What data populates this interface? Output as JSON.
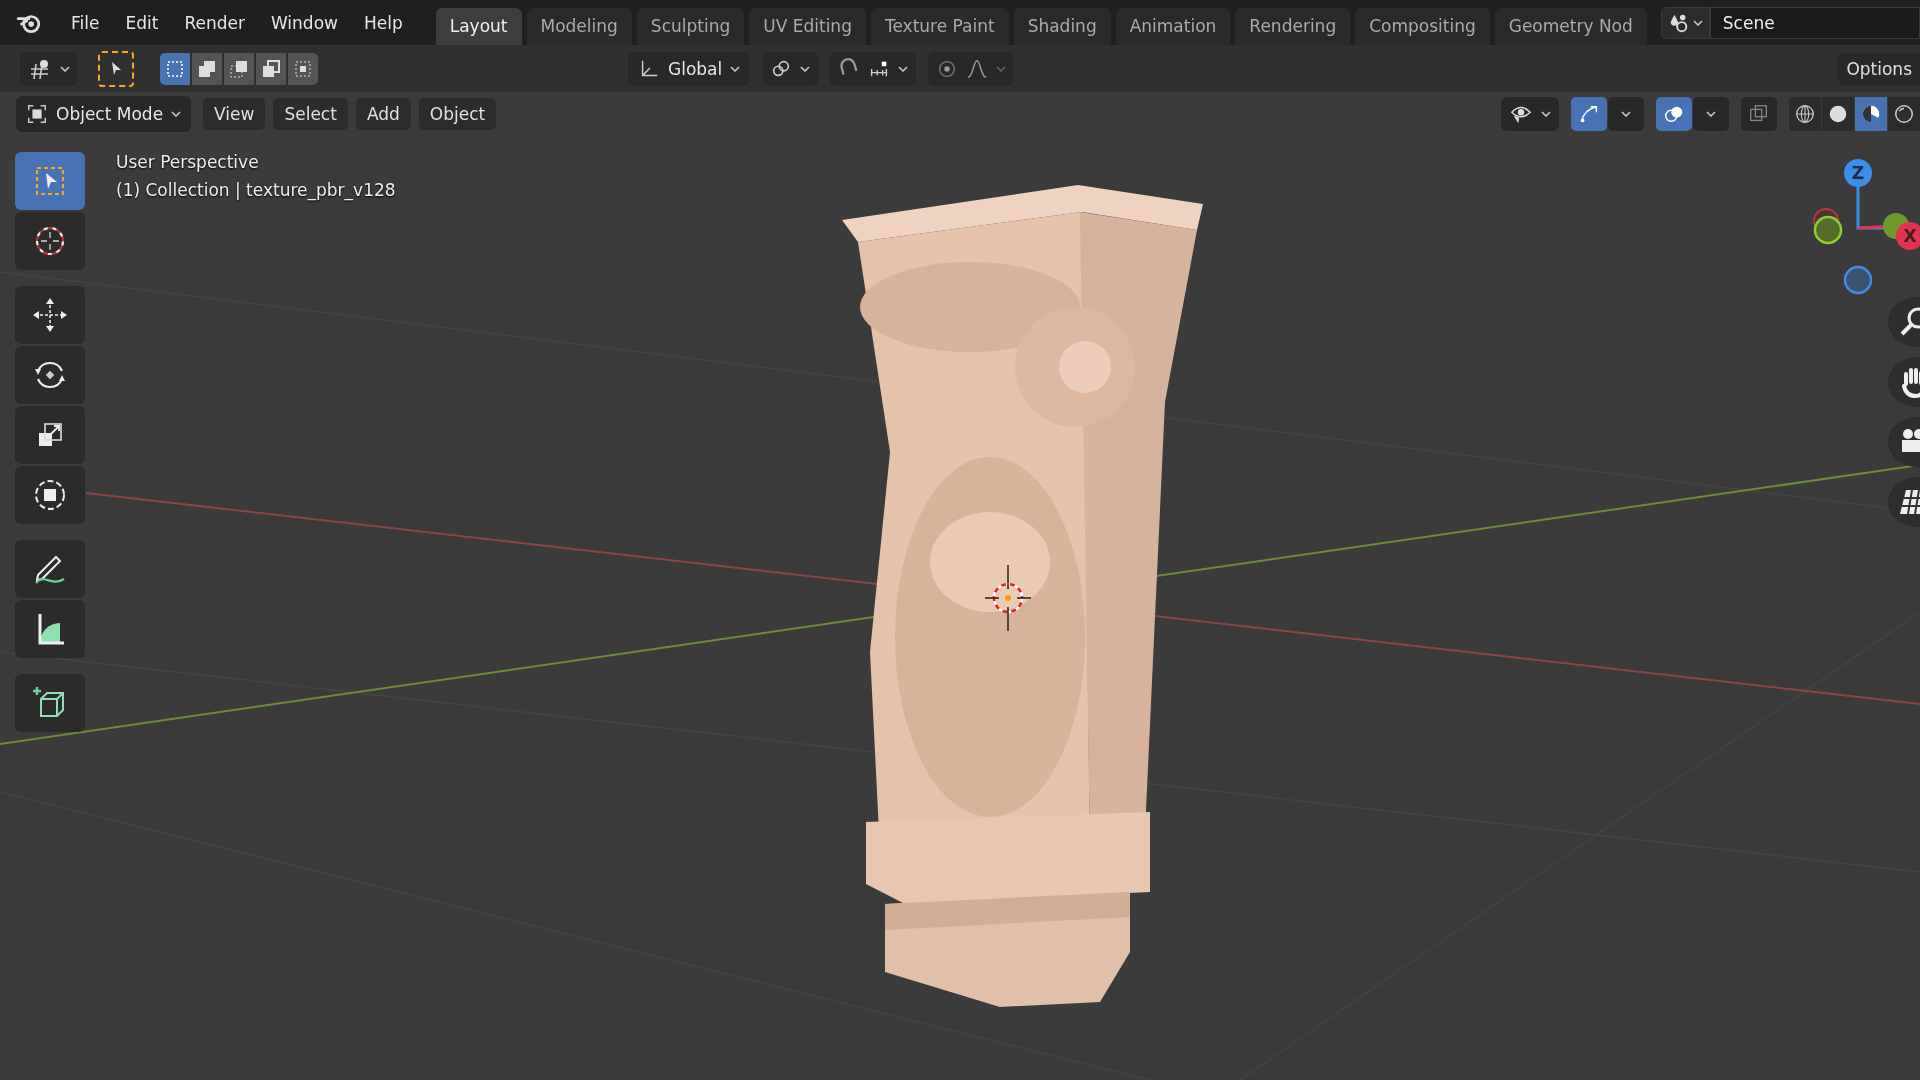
{
  "menu": [
    "File",
    "Edit",
    "Render",
    "Window",
    "Help"
  ],
  "workspace_tabs": [
    {
      "label": "Layout",
      "selected": true
    },
    {
      "label": "Modeling",
      "selected": false
    },
    {
      "label": "Sculpting",
      "selected": false
    },
    {
      "label": "UV Editing",
      "selected": false
    },
    {
      "label": "Texture Paint",
      "selected": false
    },
    {
      "label": "Shading",
      "selected": false
    },
    {
      "label": "Animation",
      "selected": false
    },
    {
      "label": "Rendering",
      "selected": false
    },
    {
      "label": "Compositing",
      "selected": false
    },
    {
      "label": "Geometry Nod",
      "selected": false
    }
  ],
  "scene": {
    "name": "Scene"
  },
  "tool_header": {
    "select_modes": [
      {
        "kind": "set",
        "selected": true
      },
      {
        "kind": "extend",
        "selected": false
      },
      {
        "kind": "subtract",
        "selected": false
      },
      {
        "kind": "invert",
        "selected": false
      },
      {
        "kind": "intersect",
        "selected": false
      }
    ],
    "orientation": "Global",
    "options": "Options"
  },
  "viewport_header": {
    "mode": "Object Mode",
    "menus": [
      "View",
      "Select",
      "Add",
      "Object"
    ],
    "toggles": [
      {
        "kind": "gizmos",
        "on": true
      },
      {
        "kind": "overlays",
        "on": true
      },
      {
        "kind": "xray",
        "on": false
      }
    ],
    "shading_modes": [
      {
        "kind": "wireframe",
        "selected": false
      },
      {
        "kind": "solid",
        "selected": false
      },
      {
        "kind": "material",
        "selected": true
      },
      {
        "kind": "rendered",
        "selected": false
      }
    ]
  },
  "viewport": {
    "view_name": "User Perspective",
    "object_info": "(1) Collection | texture_pbr_v128"
  },
  "toolbar": [
    {
      "kind": "select",
      "selected": true
    },
    {
      "kind": "cursor",
      "selected": false
    },
    {
      "kind": "move",
      "selected": false
    },
    {
      "kind": "rotate",
      "selected": false
    },
    {
      "kind": "scale",
      "selected": false
    },
    {
      "kind": "transform",
      "selected": false
    },
    {
      "kind": "annotate",
      "selected": false
    },
    {
      "kind": "measure",
      "selected": false
    },
    {
      "kind": "add_cube",
      "selected": false
    }
  ],
  "gizmo": {
    "axes": [
      "Z",
      "X"
    ]
  }
}
